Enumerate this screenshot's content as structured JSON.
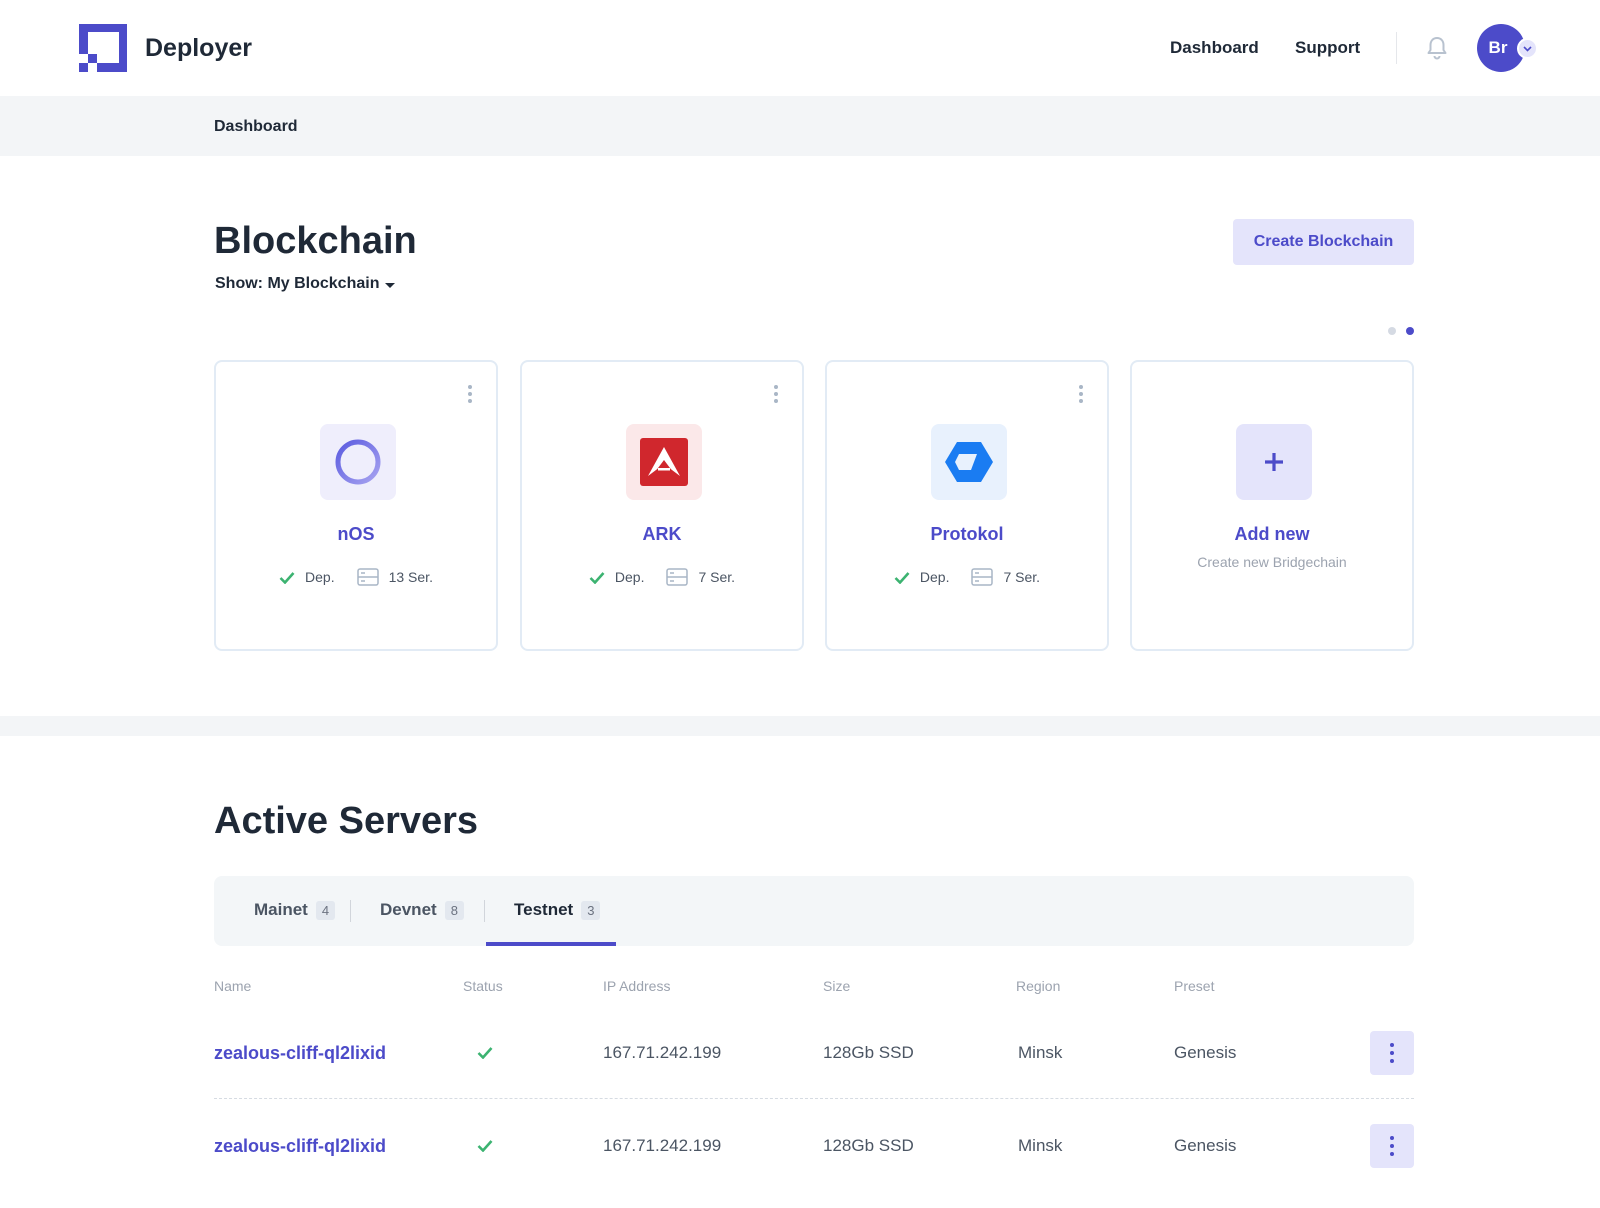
{
  "header": {
    "brand": "Deployer",
    "nav": [
      "Dashboard",
      "Support"
    ],
    "avatar_initials": "Br"
  },
  "breadcrumb": "Dashboard",
  "blockchain": {
    "title": "Blockchain",
    "show_label": "Show: My Blockchain",
    "create_button": "Create Blockchain",
    "pager_active": 2,
    "cards": [
      {
        "name": "nOS",
        "status": "Dep.",
        "servers": "13 Ser.",
        "logo": "nos-ring-logo"
      },
      {
        "name": "ARK",
        "status": "Dep.",
        "servers": "7 Ser.",
        "logo": "ark-logo"
      },
      {
        "name": "Protokol",
        "status": "Dep.",
        "servers": "7 Ser.",
        "logo": "protokol-hexagon-logo"
      }
    ],
    "add_card": {
      "title": "Add new",
      "subtitle": "Create new Bridgechain"
    }
  },
  "servers": {
    "title": "Active Servers",
    "tabs": [
      {
        "label": "Mainet",
        "count": "4"
      },
      {
        "label": "Devnet",
        "count": "8"
      },
      {
        "label": "Testnet",
        "count": "3"
      }
    ],
    "active_tab": "Testnet",
    "columns": [
      "Name",
      "Status",
      "IP Address",
      "Size",
      "Region",
      "Preset"
    ],
    "rows": [
      {
        "name": "zealous-cliff-ql2lixid",
        "status": "ok",
        "ip": "167.71.242.199",
        "size": "128Gb SSD",
        "region": "Minsk",
        "preset": "Genesis"
      },
      {
        "name": "zealous-cliff-ql2lixid",
        "status": "ok",
        "ip": "167.71.242.199",
        "size": "128Gb SSD",
        "region": "Minsk",
        "preset": "Genesis"
      }
    ]
  },
  "colors": {
    "accent": "#4c4bc9",
    "accent_light": "#e4e4fb",
    "success": "#3cb371",
    "ark_red": "#d0272d",
    "protokol_blue": "#1a7cf2"
  }
}
